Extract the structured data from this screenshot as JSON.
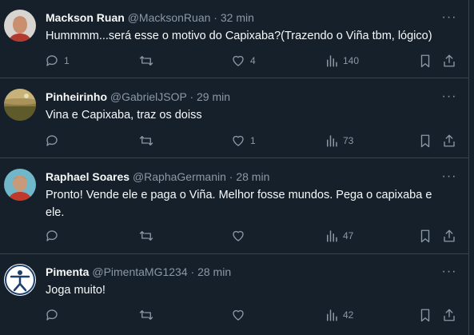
{
  "tweets": [
    {
      "name": "Mackson Ruan",
      "handle": "@MacksonRuan",
      "dot": "·",
      "time": "32 min",
      "text_lines": [
        "Hummmm...será esse o motivo do Capixaba?(Trazendo o Viña tbm, lógico)"
      ],
      "replies": "1",
      "retweets": "",
      "likes": "4",
      "views": "140"
    },
    {
      "name": "Pinheirinho",
      "handle": "@GabrielJSOP",
      "dot": "·",
      "time": "29 min",
      "text_lines": [
        "Vina e Capixaba, traz os doiss"
      ],
      "replies": "",
      "retweets": "",
      "likes": "1",
      "views": "73"
    },
    {
      "name": "Raphael Soares",
      "handle": "@RaphaGermanin",
      "dot": "·",
      "time": "28 min",
      "text_lines": [
        "Pronto! Vende ele e paga o Viña. Melhor fosse mundos. Pega o capixaba e",
        "ele."
      ],
      "replies": "",
      "retweets": "",
      "likes": "",
      "views": "47"
    },
    {
      "name": "Pimenta",
      "handle": "@PimentaMG1234",
      "dot": "·",
      "time": "28 min",
      "text_lines": [
        "Joga muito!"
      ],
      "replies": "",
      "retweets": "",
      "likes": "",
      "views": "42"
    }
  ],
  "more_label": "···",
  "colors": {
    "background": "#15202b",
    "divider": "#38444d",
    "secondary_text": "#8b98a5",
    "primary_text": "#f7f9f9"
  },
  "icons": [
    "avatar",
    "more-icon",
    "reply-icon",
    "retweet-icon",
    "like-icon",
    "views-icon",
    "bookmark-icon",
    "share-icon"
  ]
}
